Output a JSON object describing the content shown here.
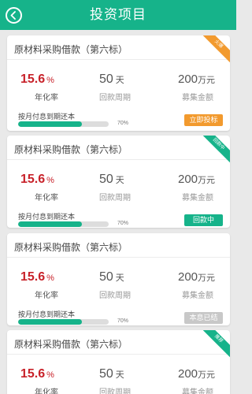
{
  "header": {
    "title": "投资项目"
  },
  "colors": {
    "brand": "#16b38a",
    "accent_orange": "#f29a2e",
    "rate_red": "#c8222a",
    "disabled_gray": "#c8c8c8"
  },
  "icons": {
    "back": "back-arrow-circle-icon"
  },
  "projects": [
    {
      "title": "原材料采购借款（第六标）",
      "ribbon": "火爆",
      "ribbon_color": "orange",
      "rate": "15.6",
      "rate_unit": "%",
      "rate_label": "年化率",
      "days": "50",
      "days_unit": "天",
      "days_label": "回款周期",
      "amount": "200",
      "amount_unit": "万元",
      "amount_label": "募集金额",
      "repayment": "按月付息到期还本",
      "progress": 0.7,
      "progress_text": "70%",
      "action": "立即投标",
      "action_color": "orange"
    },
    {
      "title": "原材料采购借款（第六标）",
      "ribbon": "回款中",
      "ribbon_color": "green",
      "rate": "15.6",
      "rate_unit": "%",
      "rate_label": "年化率",
      "days": "50",
      "days_unit": "天",
      "days_label": "回款周期",
      "amount": "200",
      "amount_unit": "万元",
      "amount_label": "募集金额",
      "repayment": "按月付息到期还本",
      "progress": 0.7,
      "progress_text": "70%",
      "action": "回款中",
      "action_color": "green"
    },
    {
      "title": "原材料采购借款（第六标）",
      "ribbon": "",
      "ribbon_color": "",
      "rate": "15.6",
      "rate_unit": "%",
      "rate_label": "年化率",
      "days": "50",
      "days_unit": "天",
      "days_label": "回款周期",
      "amount": "200",
      "amount_unit": "万元",
      "amount_label": "募集金额",
      "repayment": "按月付息到期还本",
      "progress": 0.7,
      "progress_text": "70%",
      "action": "本息已结",
      "action_color": "gray"
    },
    {
      "title": "原材料采购借款（第六标）",
      "ribbon": "推荐",
      "ribbon_color": "green",
      "rate": "15.6",
      "rate_unit": "%",
      "rate_label": "年化率",
      "days": "50",
      "days_unit": "天",
      "days_label": "回款周期",
      "amount": "200",
      "amount_unit": "万元",
      "amount_label": "募集金额"
    }
  ]
}
